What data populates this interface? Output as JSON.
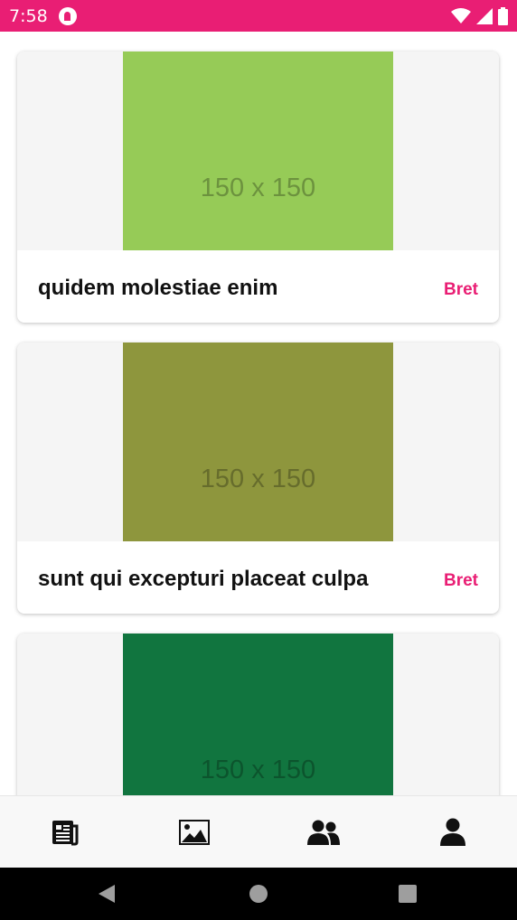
{
  "status_bar": {
    "time": "7:58",
    "color": "#e91e74",
    "icons": [
      "app-notification-icon",
      "wifi-icon",
      "cell-signal-icon",
      "battery-icon"
    ]
  },
  "posts": [
    {
      "image_label": "150 x 150",
      "image_color": "#96cb57",
      "title": "quidem molestiae enim",
      "author": "Bret"
    },
    {
      "image_label": "150 x 150",
      "image_color": "#8e963d",
      "title": "sunt qui excepturi placeat culpa",
      "author": "Bret"
    },
    {
      "image_label": "150 x 150",
      "image_color": "#11753f",
      "title": "",
      "author": ""
    }
  ],
  "bottom_nav": {
    "tabs": [
      {
        "icon": "newspaper-icon"
      },
      {
        "icon": "image-icon"
      },
      {
        "icon": "users-icon"
      },
      {
        "icon": "user-icon"
      }
    ]
  },
  "accent_color": "#e91e74"
}
